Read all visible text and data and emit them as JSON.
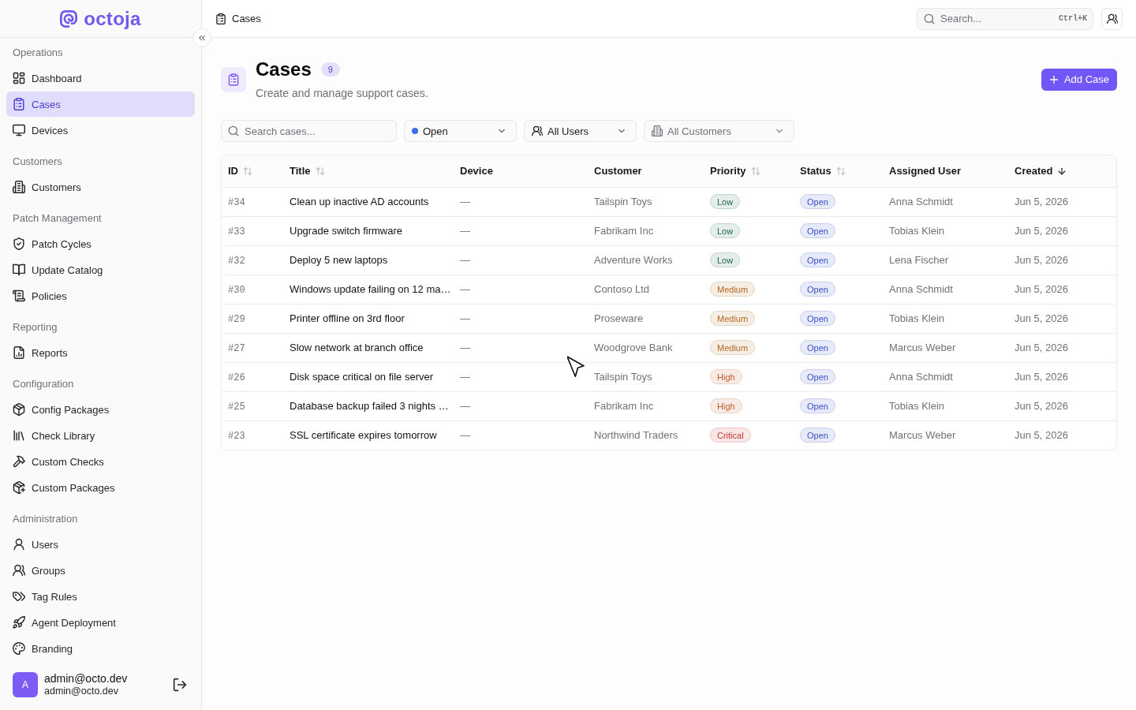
{
  "sidebar": {
    "logo": {
      "text": "octoja"
    },
    "sections": [
      {
        "title": "Operations",
        "items": [
          {
            "label": "Dashboard",
            "selected": false
          },
          {
            "label": "Cases",
            "selected": true
          },
          {
            "label": "Devices",
            "selected": false
          }
        ]
      },
      {
        "title": "Customers",
        "items": [
          {
            "label": "Customers",
            "selected": false
          }
        ]
      },
      {
        "title": "Patch Management",
        "items": [
          {
            "label": "Patch Cycles",
            "selected": false
          },
          {
            "label": "Update Catalog",
            "selected": false
          },
          {
            "label": "Policies",
            "selected": false
          }
        ]
      },
      {
        "title": "Reporting",
        "items": [
          {
            "label": "Reports",
            "selected": false
          }
        ]
      },
      {
        "title": "Configuration",
        "items": [
          {
            "label": "Config Packages",
            "selected": false
          },
          {
            "label": "Check Library",
            "selected": false
          },
          {
            "label": "Custom Checks",
            "selected": false
          },
          {
            "label": "Custom Packages",
            "selected": false
          }
        ]
      },
      {
        "title": "Administration",
        "items": [
          {
            "label": "Users",
            "selected": false
          },
          {
            "label": "Groups",
            "selected": false
          },
          {
            "label": "Tag Rules",
            "selected": false
          },
          {
            "label": "Agent Deployment",
            "selected": false
          },
          {
            "label": "Branding",
            "selected": false
          }
        ]
      }
    ],
    "user": {
      "avatar": "A",
      "name": "admin@octo.dev",
      "email": "admin@octo.dev"
    }
  },
  "topbar": {
    "breadcrumb": "Cases",
    "search": {
      "placeholder": "Search...",
      "shortcut": "Ctrl+K"
    }
  },
  "page": {
    "title": "Cases",
    "count": "9",
    "subtitle": "Create and manage support cases.",
    "add_button": "Add Case"
  },
  "filters": {
    "search": {
      "placeholder": "Search cases..."
    },
    "selects": [
      {
        "kind": "status",
        "value": "Open",
        "color": "#3b6ef0",
        "disabled": false
      },
      {
        "kind": "user",
        "value": "All Users",
        "disabled": false
      },
      {
        "kind": "customer",
        "value": "All Customers",
        "disabled": true
      }
    ]
  },
  "table": {
    "columns": [
      {
        "label": "ID",
        "sortable": true,
        "sorted": false
      },
      {
        "label": "Title",
        "sortable": true,
        "sorted": false
      },
      {
        "label": "Device",
        "sortable": false,
        "sorted": false
      },
      {
        "label": "Customer",
        "sortable": false,
        "sorted": false
      },
      {
        "label": "Priority",
        "sortable": true,
        "sorted": false
      },
      {
        "label": "Status",
        "sortable": true,
        "sorted": false
      },
      {
        "label": "Assigned User",
        "sortable": false,
        "sorted": false
      },
      {
        "label": "Created",
        "sortable": true,
        "sorted": true
      }
    ],
    "rows": [
      {
        "id": "#34",
        "title": "Clean up inactive AD accounts",
        "device": "—",
        "customer": "Tailspin Toys",
        "priority": {
          "label": "Low",
          "color": "#1e6b47"
        },
        "status": {
          "label": "Open",
          "color": "#3a50c2"
        },
        "assigned_user": "Anna Schmidt",
        "created": "Jun 5, 2026"
      },
      {
        "id": "#33",
        "title": "Upgrade switch firmware",
        "device": "—",
        "customer": "Fabrikam Inc",
        "priority": {
          "label": "Low",
          "color": "#1e6b47"
        },
        "status": {
          "label": "Open",
          "color": "#3a50c2"
        },
        "assigned_user": "Tobias Klein",
        "created": "Jun 5, 2026"
      },
      {
        "id": "#32",
        "title": "Deploy 5 new laptops",
        "device": "—",
        "customer": "Adventure Works",
        "priority": {
          "label": "Low",
          "color": "#1e6b47"
        },
        "status": {
          "label": "Open",
          "color": "#3a50c2"
        },
        "assigned_user": "Lena Fischer",
        "created": "Jun 5, 2026"
      },
      {
        "id": "#30",
        "title": "Windows update failing on 12 ma…",
        "device": "—",
        "customer": "Contoso Ltd",
        "priority": {
          "label": "Medium",
          "color": "#b4691f"
        },
        "status": {
          "label": "Open",
          "color": "#3a50c2"
        },
        "assigned_user": "Anna Schmidt",
        "created": "Jun 5, 2026"
      },
      {
        "id": "#29",
        "title": "Printer offline on 3rd floor",
        "device": "—",
        "customer": "Proseware",
        "priority": {
          "label": "Medium",
          "color": "#b4691f"
        },
        "status": {
          "label": "Open",
          "color": "#3a50c2"
        },
        "assigned_user": "Tobias Klein",
        "created": "Jun 5, 2026"
      },
      {
        "id": "#27",
        "title": "Slow network at branch office",
        "device": "—",
        "customer": "Woodgrove Bank",
        "priority": {
          "label": "Medium",
          "color": "#b4691f"
        },
        "status": {
          "label": "Open",
          "color": "#3a50c2"
        },
        "assigned_user": "Marcus Weber",
        "created": "Jun 5, 2026"
      },
      {
        "id": "#26",
        "title": "Disk space critical on file server",
        "device": "—",
        "customer": "Tailspin Toys",
        "priority": {
          "label": "High",
          "color": "#c25a26"
        },
        "status": {
          "label": "Open",
          "color": "#3a50c2"
        },
        "assigned_user": "Anna Schmidt",
        "created": "Jun 5, 2026"
      },
      {
        "id": "#25",
        "title": "Database backup failed 3 nights …",
        "device": "—",
        "customer": "Fabrikam Inc",
        "priority": {
          "label": "High",
          "color": "#c25a26"
        },
        "status": {
          "label": "Open",
          "color": "#3a50c2"
        },
        "assigned_user": "Tobias Klein",
        "created": "Jun 5, 2026"
      },
      {
        "id": "#23",
        "title": "SSL certificate expires tomorrow",
        "device": "—",
        "customer": "Northwind Traders",
        "priority": {
          "label": "Critical",
          "color": "#c73a2f"
        },
        "status": {
          "label": "Open",
          "color": "#3a50c2"
        },
        "assigned_user": "Marcus Weber",
        "created": "Jun 5, 2026"
      }
    ]
  }
}
